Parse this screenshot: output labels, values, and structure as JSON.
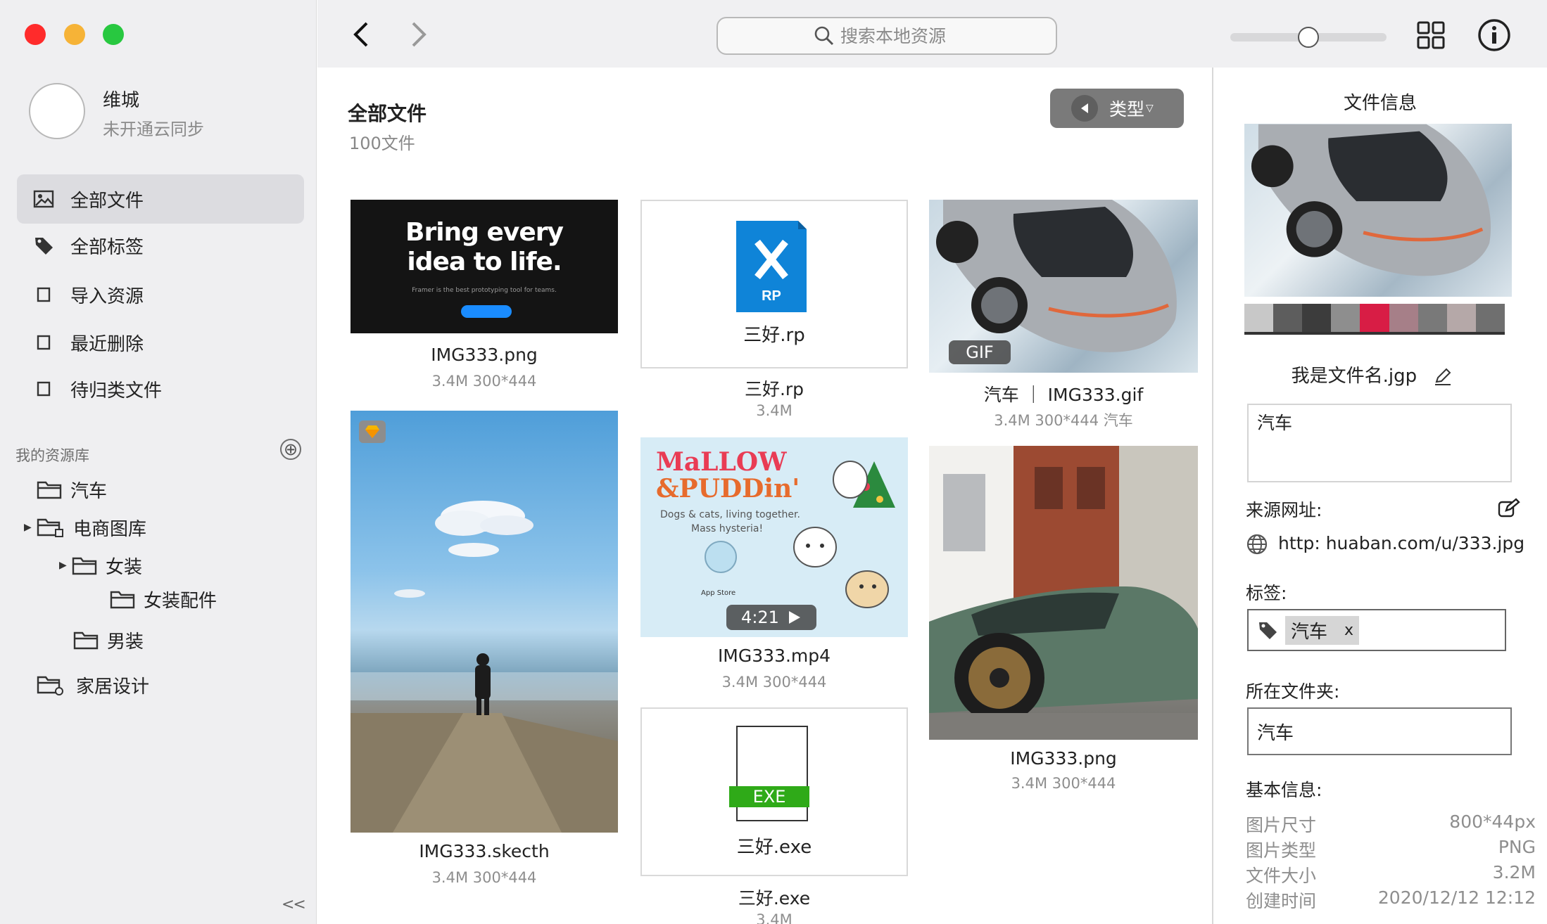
{
  "window": {
    "traffic_colors": [
      "#ff2b2b",
      "#f6b337",
      "#28c840"
    ]
  },
  "user": {
    "name": "维城",
    "status": "未开通云同步"
  },
  "nav": [
    {
      "label": "全部文件",
      "icon": "image-icon",
      "active": true
    },
    {
      "label": "全部标签",
      "icon": "tag-icon",
      "active": false
    },
    {
      "label": "导入资源",
      "icon": "square-icon",
      "active": false
    },
    {
      "label": "最近删除",
      "icon": "square-icon",
      "active": false
    },
    {
      "label": "待归类文件",
      "icon": "square-icon",
      "active": false
    }
  ],
  "library": {
    "title": "我的资源库",
    "add_icon": "⊕",
    "items": [
      {
        "label": "汽车"
      },
      {
        "label": "电商图库"
      },
      {
        "label": "女装"
      },
      {
        "label": "女装配件"
      },
      {
        "label": "男装"
      },
      {
        "label": "家居设计"
      }
    ],
    "collapse_label": "<<"
  },
  "toolbar": {
    "search_placeholder": "搜索本地资源",
    "zoom_level": 0.5
  },
  "main": {
    "title": "全部文件",
    "count": "100文件",
    "filter_label": "类型"
  },
  "files": [
    {
      "caption": "IMG333.png",
      "meta": "3.4M  300*444",
      "headline1": "Bring every",
      "headline2": "idea to life.",
      "subline": "Framer is the best prototyping tool for teams."
    },
    {
      "caption": "IMG333.skecth",
      "meta": "3.4M  300*444"
    },
    {
      "inner": "三好.rp",
      "caption": "三好.rp",
      "meta": "3.4M",
      "badge": "RP"
    },
    {
      "caption": "IMG333.mp4",
      "meta": "3.4M  300*444",
      "title1": "MaLLOW",
      "title2": "&PUDDin'",
      "tagline1": "Dogs & cats, living together.",
      "tagline2": "Mass hysteria!",
      "store": "App Store",
      "duration": "4:21"
    },
    {
      "inner": "三好.exe",
      "caption": "三好.exe",
      "meta": "3.4M",
      "badge": "EXE"
    },
    {
      "caption": "汽车 ｜ IMG333.gif",
      "meta": "3.4M  300*444  汽车",
      "badge": "GIF"
    },
    {
      "caption": "IMG333.png",
      "meta": "3.4M  300*444"
    }
  ],
  "panel": {
    "title": "文件信息",
    "palette": [
      "#c8c8c8",
      "#5d5d5d",
      "#3c3c3c",
      "#8e8e8e",
      "#d81d45",
      "#a67f88",
      "#797979",
      "#b5a8a8",
      "#6f6f6f"
    ],
    "file_name": "我是文件名.jgp",
    "description": "汽车",
    "source_label": "来源网址:",
    "source_url": "http:  huaban.com/u/333.jpg",
    "tags_label": "标签:",
    "tag": "汽车",
    "tag_remove": "x",
    "folder_label": "所在文件夹:",
    "folder": "汽车",
    "basic_label": "基本信息:",
    "info": [
      {
        "key": "图片尺寸",
        "value": "800*44px"
      },
      {
        "key": "图片类型",
        "value": "PNG"
      },
      {
        "key": "文件大小",
        "value": "3.2M"
      },
      {
        "key": "创建时间",
        "value": "2020/12/12 12:12"
      }
    ]
  }
}
